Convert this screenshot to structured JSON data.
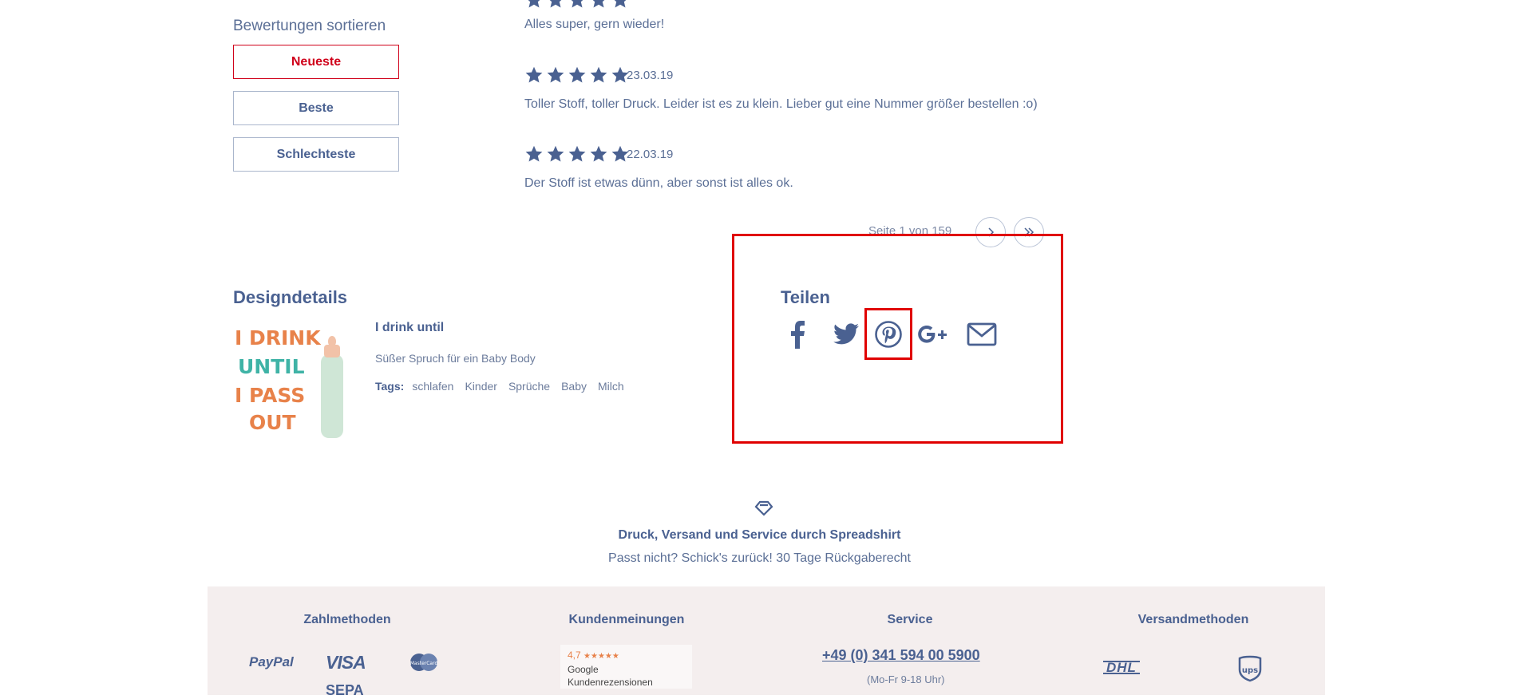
{
  "sort": {
    "title": "Bewertungen sortieren",
    "options": [
      "Neueste",
      "Beste",
      "Schlechteste"
    ],
    "active": "Neueste"
  },
  "reviews": [
    {
      "text": "Alles super, gern wieder!",
      "stars": 5
    },
    {
      "date": "23.03.19",
      "text": "Toller Stoff, toller Druck. Leider ist es zu klein. Lieber gut eine Nummer größer bestellen :o)",
      "stars": 5
    },
    {
      "date": "22.03.19",
      "text": "Der Stoff ist etwas dünn, aber sonst ist alles ok.",
      "stars": 5
    }
  ],
  "pagination": {
    "text": "Seite 1 von 159",
    "next_icon": "chevron-right-icon",
    "last_icon": "double-chevron-right-icon"
  },
  "design": {
    "section_title": "Designdetails",
    "name": "I drink until",
    "description": "Süßer Spruch für ein Baby Body",
    "tags_label": "Tags:",
    "tags": [
      "schlafen",
      "Kinder",
      "Sprüche",
      "Baby",
      "Milch"
    ],
    "artwork_text": [
      "I DRINK",
      "UNTIL",
      "I PASS",
      "OUT"
    ]
  },
  "share": {
    "title": "Teilen",
    "icons": [
      "facebook-icon",
      "twitter-icon",
      "pinterest-icon",
      "google-plus-icon",
      "email-icon"
    ]
  },
  "service": {
    "title": "Druck, Versand und Service durch Spreadshirt",
    "subtitle": "Passt nicht? Schick's zurück! 30 Tage Rückgaberecht"
  },
  "footer": {
    "payment_title": "Zahlmethoden",
    "payment_methods": [
      "PayPal",
      "VISA",
      "MasterCard",
      "SEPA"
    ],
    "reviews_title": "Kundenmeinungen",
    "review_badge": {
      "rating": "4,7",
      "source": "Google",
      "label": "Kundenrezensionen"
    },
    "service_title": "Service",
    "phone": "+49 (0) 341 594 00 5900",
    "hours": "(Mo-Fr 9-18 Uhr)",
    "shipping_title": "Versandmethoden",
    "shipping_methods": [
      "DHL",
      "ups"
    ]
  },
  "colors": {
    "accent": "#4a6191",
    "highlight": "#e00000",
    "active_sort": "#d0021b",
    "footer_bg": "#f4eeee"
  }
}
